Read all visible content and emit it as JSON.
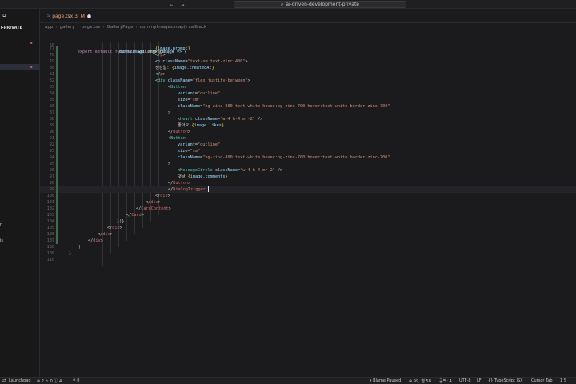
{
  "titlebar": {
    "back": "←",
    "forward": "→",
    "search_text": "ai-driven-development-private",
    "search_icon": "⌕"
  },
  "sidebar": {
    "icon": "⧉",
    "project": "T-PRIVATE",
    "item_dot1": "●",
    "item_dot2": "●",
    "label_n": "n",
    "label_js": "js"
  },
  "tab": {
    "icon": "TS",
    "label": "page.tsx 3, M",
    "dirty": "●"
  },
  "breadcrumb": [
    "app",
    "gallery",
    "page.tsx",
    "GalleryPage",
    "dummyImages.map() callback"
  ],
  "code": {
    "sticky1": {
      "num": "45",
      "kw1": "export",
      "kw2": "default",
      "kw3": "function",
      "fn": "GalleryPage",
      "rest": "() {"
    },
    "sticky2": {
      "num": "58",
      "text": "{dummyImages.map((image => {"
    },
    "lines": [
      {
        "num": "77",
        "text": "{image.prompt}"
      },
      {
        "num": "78",
        "text": "</p>"
      },
      {
        "num": "79",
        "text": "<p className=\"text-sm text-zinc-400\">"
      },
      {
        "num": "80",
        "text": "생성일: {image.createdAt}"
      },
      {
        "num": "81",
        "text": "</p>"
      },
      {
        "num": "82",
        "text": "<div className=\"flex justify-between\">"
      },
      {
        "num": "83",
        "text": "<Button"
      },
      {
        "num": "84",
        "text": "variant=\"outline\""
      },
      {
        "num": "85",
        "text": "size=\"sm\""
      },
      {
        "num": "86",
        "text": "className=\"bg-zinc-800 text-white hover:bg-zinc-700 hover:text-white border-zinc-700\""
      },
      {
        "num": "87",
        "text": ">"
      },
      {
        "num": "88",
        "text": "<Heart className=\"w-4 h-4 mr-2\" />"
      },
      {
        "num": "89",
        "text": "좋아요 {image.likes}"
      },
      {
        "num": "90",
        "text": "</Button>"
      },
      {
        "num": "91",
        "text": "<Button"
      },
      {
        "num": "92",
        "text": "variant=\"outline\""
      },
      {
        "num": "93",
        "text": "size=\"sm\""
      },
      {
        "num": "94",
        "text": "className=\"bg-zinc-800 text-white hover:bg-zinc-700 hover:text-white border-zinc-700\""
      },
      {
        "num": "95",
        "text": ">"
      },
      {
        "num": "96",
        "text": "<MessageCircle className=\"w-4 h-4 mr-2\" />"
      },
      {
        "num": "97",
        "text": "댓글 {image.comments}"
      },
      {
        "num": "98",
        "text": "</Button>"
      },
      {
        "num": "99",
        "text": "</DialogTrigger"
      },
      {
        "num": "100",
        "text": "</div>"
      },
      {
        "num": "101",
        "text": "</div>"
      },
      {
        "num": "102",
        "text": "</CardContent>"
      },
      {
        "num": "103",
        "text": "</Card>"
      },
      {
        "num": "104",
        "text": "})}"
      },
      {
        "num": "105",
        "text": "</div>"
      },
      {
        "num": "106",
        "text": "</div>"
      },
      {
        "num": "107",
        "text": "</div>"
      },
      {
        "num": "108",
        "text": ")"
      },
      {
        "num": "109",
        "text": "}"
      },
      {
        "num": "110",
        "text": ""
      }
    ]
  },
  "statusbar": {
    "launchpad": "Launchpad",
    "errors": "2",
    "warnings": "0",
    "info": "4",
    "ports": "0",
    "blame": "Blame Paused",
    "position": "99, 열 58",
    "spaces": "공백: 4",
    "encoding": "UTF-8",
    "eol": "LF",
    "language": "TypeScript JSX",
    "cursor_tab": "Cursor Tab",
    "extra": "1 S"
  }
}
